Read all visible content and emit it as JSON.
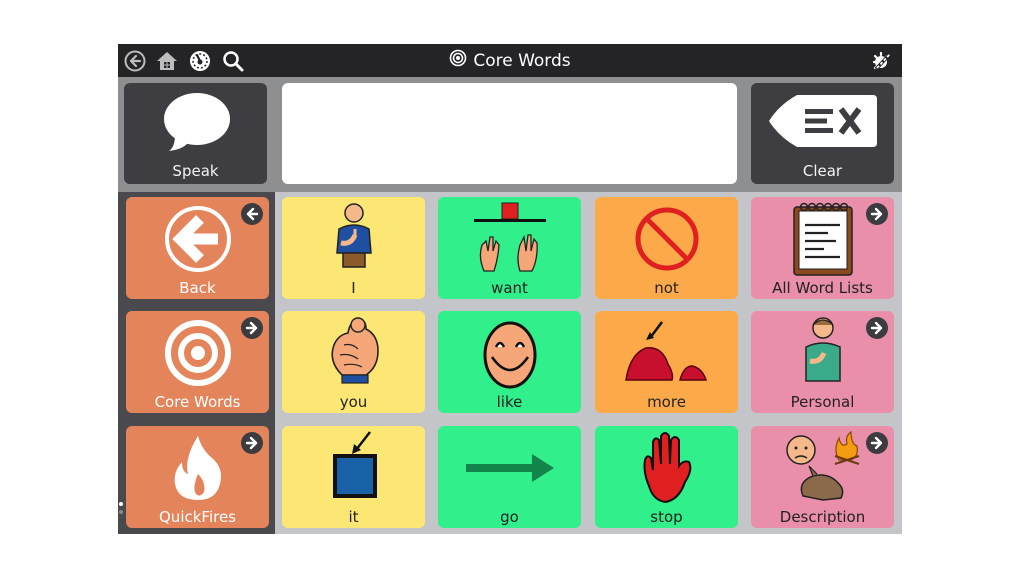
{
  "topbar": {
    "title": "Core Words",
    "icons": [
      "back-circle-icon",
      "home-icon",
      "dashboard-icon",
      "search-icon"
    ],
    "edit_icon": "edit-magic-wand-icon"
  },
  "message_row": {
    "speak_label": "Speak",
    "message_text": "",
    "clear_label": "Clear"
  },
  "nav_buttons": [
    {
      "label": "Back",
      "icon": "back-arrow-circle-icon",
      "color": "#e4845a"
    },
    {
      "label": "Core Words",
      "icon": "target-icon",
      "color": "#e4845a"
    },
    {
      "label": "QuickFires",
      "icon": "fire-icon",
      "color": "#e4845a"
    }
  ],
  "grid": {
    "cells": [
      {
        "label": "I",
        "color": "#fce774",
        "link": false
      },
      {
        "label": "want",
        "color": "#31ef8a",
        "link": false
      },
      {
        "label": "not",
        "color": "#fca94a",
        "link": false
      },
      {
        "label": "All Word Lists",
        "color": "#e98fa9",
        "link": true
      },
      {
        "label": "you",
        "color": "#fce774",
        "link": false
      },
      {
        "label": "like",
        "color": "#31ef8a",
        "link": false
      },
      {
        "label": "more",
        "color": "#fca94a",
        "link": false
      },
      {
        "label": "Personal",
        "color": "#e98fa9",
        "link": true
      },
      {
        "label": "it",
        "color": "#fce774",
        "link": false
      },
      {
        "label": "go",
        "color": "#31ef8a",
        "link": false
      },
      {
        "label": "stop",
        "color": "#31ef8a",
        "link": false
      },
      {
        "label": "Description",
        "color": "#e98fa9",
        "link": true
      }
    ]
  },
  "page_indicator": {
    "pages": 2,
    "current": 1
  }
}
